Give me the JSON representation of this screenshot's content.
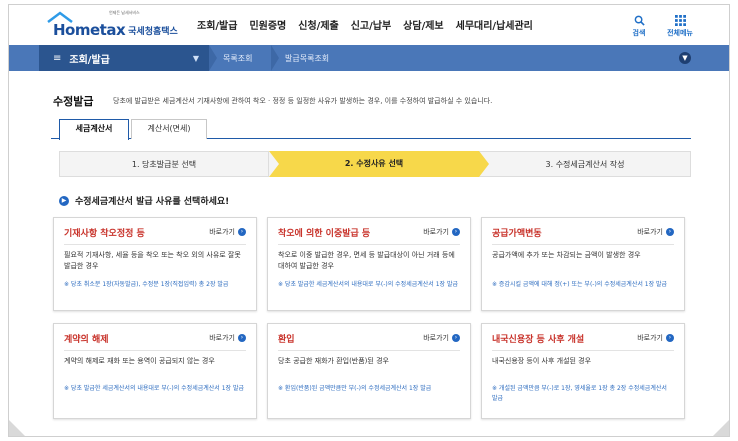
{
  "header": {
    "logo_brand": "Hometax",
    "logo_kr": "국세청홈택스",
    "logo_tagline": "언제든 납세서비스",
    "menu": [
      "조회/발급",
      "민원증명",
      "신청/제출",
      "신고/납부",
      "상담/제보",
      "세무대리/납세관리"
    ],
    "search_label": "검색",
    "all_menu_label": "전체메뉴"
  },
  "subnav": {
    "section": "조회/발급",
    "crumb1": "목록조회",
    "crumb2": "발급목록조회"
  },
  "page": {
    "title": "수정발급",
    "description": "당초에 발급받은 세금계산서 기재사항에 관하여 착오 · 정정 등 일정한 사유가 발생하는 경우, 이를 수정하여 발급하실 수 있습니다."
  },
  "tabs": [
    "세금계산서",
    "계산서(면세)"
  ],
  "steps": [
    "1. 당초발급분 선택",
    "2. 수정사유 선택",
    "3. 수정세금계산서 작성"
  ],
  "section_heading": "수정세금계산서 발급 사유를 선택하세요!",
  "go_label": "바로가기",
  "cards": [
    {
      "title": "기재사항 착오정정 등",
      "body": "필요적 기재사항, 세율 등을 착오 또는 착오 외의 사유로 잘못 발급한 경우",
      "note": "※ 당초 취소분 1장(자동발급), 수정분 1장(직접입력) 총 2장 발급"
    },
    {
      "title": "착오에 의한 이중발급 등",
      "body": "착오로 이중 발급한 경우, 면세 등 발급대상이 아닌 거래 등에 대하여 발급한 경우",
      "note": "※ 당초 발급한 세금계산서의 내용대로 부(-)의 수정세금계산서 1장 발급"
    },
    {
      "title": "공급가액변동",
      "body": "공급가액에 추가 또는 차감되는 금액이 발생한 경우",
      "note": "※ 증감시킬 금액에 대해 정(+) 또는 부(-)의 수정세금계산서 1장 발급"
    },
    {
      "title": "계약의 해제",
      "body": "계약의 해제로 재화 또는 용역이 공급되지 않는 경우",
      "note": "※ 당초 발급한 세금계산서의 내용대로 부(-)의 수정세금계산서 1장 발급"
    },
    {
      "title": "환입",
      "body": "당초 공급한 재화가 환입(반품)된 경우",
      "note": "※ 환입(반품)된 금액만큼만 부(-)의 수정세금계산서 1장 발급"
    },
    {
      "title": "내국신용장 등 사후 개설",
      "body": "내국신용장 등이 사후 개설된 경우",
      "note": "※ 개설된 금액만큼 부(-)로 1장, 영세율로 1장 총 2장 수정세금계산서 발급"
    }
  ],
  "colors": {
    "brand": "#1b4f9c",
    "bar": "#4a77b8",
    "active_step": "#f7d84a",
    "card_title": "#c8322a",
    "note": "#2b6bbf"
  }
}
